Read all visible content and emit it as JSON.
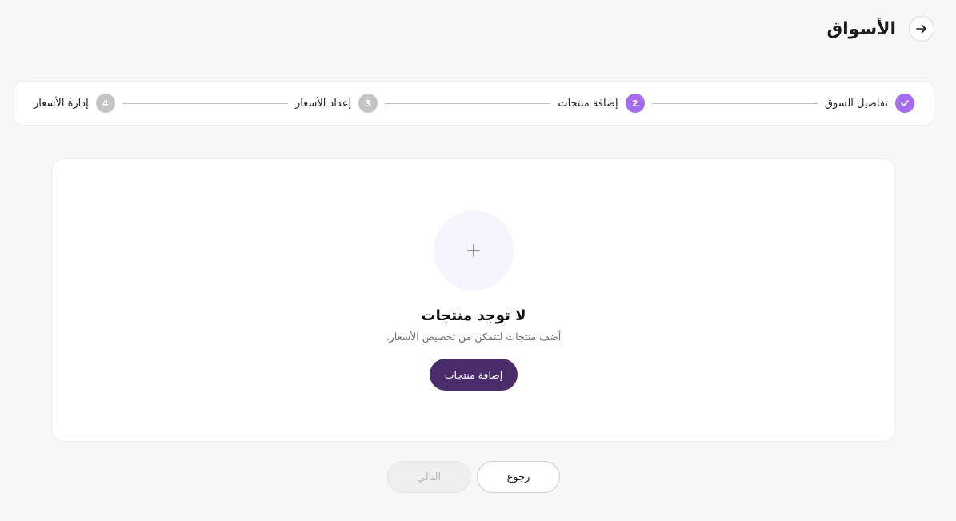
{
  "header": {
    "title": "الأسواق",
    "back_icon": "arrow-right-icon"
  },
  "stepper": {
    "steps": [
      {
        "number": "",
        "label": "تفاصيل السوق",
        "state": "done",
        "icon": "check-icon"
      },
      {
        "number": "2",
        "label": "إضافة منتجات",
        "state": "active"
      },
      {
        "number": "3",
        "label": "إعداد الأسعار",
        "state": "pending"
      },
      {
        "number": "4",
        "label": "إدارة الأسعار",
        "state": "pending"
      }
    ]
  },
  "empty_state": {
    "icon": "plus-icon",
    "title": "لا توجد منتجات",
    "subtitle": "أضف منتجات لتتمكن من تخصيص الأسعار.",
    "button_label": "إضافة منتجات"
  },
  "footer": {
    "back_label": "رجوع",
    "next_label": "التالي",
    "next_disabled": true
  },
  "colors": {
    "accent": "#a66cf0",
    "primary_button": "#4a2c6a",
    "pending_step": "#c4c4c6",
    "background": "#f7f7f7"
  }
}
